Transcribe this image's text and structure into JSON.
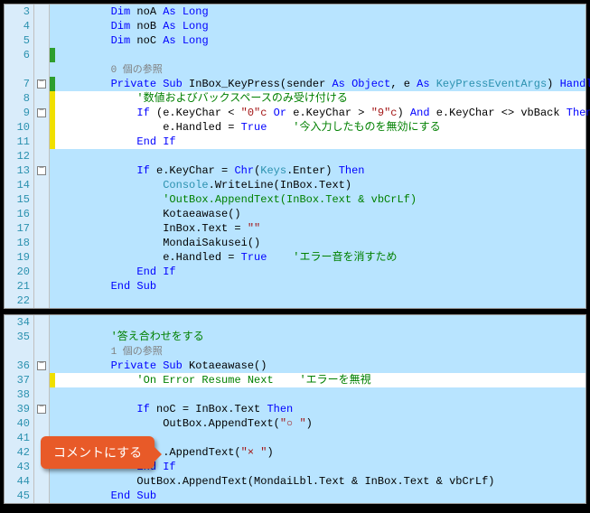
{
  "pane1": {
    "lines": [
      {
        "n": "3",
        "fold": "",
        "marker": "",
        "hl": false,
        "segs": [
          {
            "cls": "",
            "txt": "        "
          },
          {
            "cls": "kw",
            "txt": "Dim"
          },
          {
            "cls": "plain",
            "txt": " noA "
          },
          {
            "cls": "kw",
            "txt": "As"
          },
          {
            "cls": "plain",
            "txt": " "
          },
          {
            "cls": "kw",
            "txt": "Long"
          }
        ]
      },
      {
        "n": "4",
        "fold": "",
        "marker": "",
        "hl": false,
        "segs": [
          {
            "cls": "",
            "txt": "        "
          },
          {
            "cls": "kw",
            "txt": "Dim"
          },
          {
            "cls": "plain",
            "txt": " noB "
          },
          {
            "cls": "kw",
            "txt": "As"
          },
          {
            "cls": "plain",
            "txt": " "
          },
          {
            "cls": "kw",
            "txt": "Long"
          }
        ]
      },
      {
        "n": "5",
        "fold": "",
        "marker": "",
        "hl": false,
        "segs": [
          {
            "cls": "",
            "txt": "        "
          },
          {
            "cls": "kw",
            "txt": "Dim"
          },
          {
            "cls": "plain",
            "txt": " noC "
          },
          {
            "cls": "kw",
            "txt": "As"
          },
          {
            "cls": "plain",
            "txt": " "
          },
          {
            "cls": "kw",
            "txt": "Long"
          }
        ]
      },
      {
        "n": "6",
        "fold": "",
        "marker": "green",
        "hl": false,
        "segs": [
          {
            "cls": "",
            "txt": ""
          }
        ]
      },
      {
        "n": "",
        "fold": "",
        "marker": "",
        "hl": false,
        "segs": [
          {
            "cls": "",
            "txt": "        "
          },
          {
            "cls": "ref",
            "txt": "0 個の参照"
          }
        ]
      },
      {
        "n": "7",
        "fold": "box",
        "marker": "green",
        "hl": false,
        "segs": [
          {
            "cls": "",
            "txt": "        "
          },
          {
            "cls": "kw",
            "txt": "Private"
          },
          {
            "cls": "plain",
            "txt": " "
          },
          {
            "cls": "kw",
            "txt": "Sub"
          },
          {
            "cls": "plain",
            "txt": " InBox_KeyPress(sender "
          },
          {
            "cls": "kw",
            "txt": "As"
          },
          {
            "cls": "plain",
            "txt": " "
          },
          {
            "cls": "kw",
            "txt": "Object"
          },
          {
            "cls": "plain",
            "txt": ", e "
          },
          {
            "cls": "kw",
            "txt": "As"
          },
          {
            "cls": "plain",
            "txt": " "
          },
          {
            "cls": "type",
            "txt": "KeyPressEventArgs"
          },
          {
            "cls": "plain",
            "txt": ") "
          },
          {
            "cls": "kw",
            "txt": "Handles"
          }
        ]
      },
      {
        "n": "8",
        "fold": "",
        "marker": "yellow",
        "hl": true,
        "segs": [
          {
            "cls": "",
            "txt": "            "
          },
          {
            "cls": "comment",
            "txt": "'数値およびバックスペースのみ受け付ける"
          }
        ]
      },
      {
        "n": "9",
        "fold": "box",
        "marker": "yellow",
        "hl": true,
        "segs": [
          {
            "cls": "",
            "txt": "            "
          },
          {
            "cls": "kw",
            "txt": "If"
          },
          {
            "cls": "plain",
            "txt": " (e.KeyChar < "
          },
          {
            "cls": "str",
            "txt": "\"0\"c"
          },
          {
            "cls": "plain",
            "txt": " "
          },
          {
            "cls": "kw",
            "txt": "Or"
          },
          {
            "cls": "plain",
            "txt": " e.KeyChar > "
          },
          {
            "cls": "str",
            "txt": "\"9\"c"
          },
          {
            "cls": "plain",
            "txt": ") "
          },
          {
            "cls": "kw",
            "txt": "And"
          },
          {
            "cls": "plain",
            "txt": " e.KeyChar <> vbBack "
          },
          {
            "cls": "kw",
            "txt": "Then"
          }
        ]
      },
      {
        "n": "10",
        "fold": "",
        "marker": "yellow",
        "hl": true,
        "segs": [
          {
            "cls": "",
            "txt": "                "
          },
          {
            "cls": "plain",
            "txt": "e.Handled = "
          },
          {
            "cls": "kw",
            "txt": "True"
          },
          {
            "cls": "plain",
            "txt": "    "
          },
          {
            "cls": "comment",
            "txt": "'今入力したものを無効にする"
          }
        ]
      },
      {
        "n": "11",
        "fold": "",
        "marker": "yellow",
        "hl": true,
        "segs": [
          {
            "cls": "",
            "txt": "            "
          },
          {
            "cls": "kw",
            "txt": "End"
          },
          {
            "cls": "plain",
            "txt": " "
          },
          {
            "cls": "kw",
            "txt": "If"
          }
        ]
      },
      {
        "n": "12",
        "fold": "",
        "marker": "",
        "hl": false,
        "segs": [
          {
            "cls": "",
            "txt": ""
          }
        ]
      },
      {
        "n": "13",
        "fold": "box",
        "marker": "",
        "hl": false,
        "segs": [
          {
            "cls": "",
            "txt": "            "
          },
          {
            "cls": "kw",
            "txt": "If"
          },
          {
            "cls": "plain",
            "txt": " e.KeyChar = "
          },
          {
            "cls": "kw",
            "txt": "Chr"
          },
          {
            "cls": "plain",
            "txt": "("
          },
          {
            "cls": "type",
            "txt": "Keys"
          },
          {
            "cls": "plain",
            "txt": ".Enter) "
          },
          {
            "cls": "kw",
            "txt": "Then"
          }
        ]
      },
      {
        "n": "14",
        "fold": "",
        "marker": "",
        "hl": false,
        "segs": [
          {
            "cls": "",
            "txt": "                "
          },
          {
            "cls": "type",
            "txt": "Console"
          },
          {
            "cls": "plain",
            "txt": ".WriteLine(InBox.Text)"
          }
        ]
      },
      {
        "n": "15",
        "fold": "",
        "marker": "",
        "hl": false,
        "segs": [
          {
            "cls": "",
            "txt": "                "
          },
          {
            "cls": "comment",
            "txt": "'OutBox.AppendText(InBox.Text & vbCrLf)"
          }
        ]
      },
      {
        "n": "16",
        "fold": "",
        "marker": "",
        "hl": false,
        "segs": [
          {
            "cls": "",
            "txt": "                "
          },
          {
            "cls": "plain",
            "txt": "Kotaeawase()"
          }
        ]
      },
      {
        "n": "17",
        "fold": "",
        "marker": "",
        "hl": false,
        "segs": [
          {
            "cls": "",
            "txt": "                "
          },
          {
            "cls": "plain",
            "txt": "InBox.Text = "
          },
          {
            "cls": "str",
            "txt": "\"\""
          }
        ]
      },
      {
        "n": "18",
        "fold": "",
        "marker": "",
        "hl": false,
        "segs": [
          {
            "cls": "",
            "txt": "                "
          },
          {
            "cls": "plain",
            "txt": "MondaiSakusei()"
          }
        ]
      },
      {
        "n": "19",
        "fold": "",
        "marker": "",
        "hl": false,
        "segs": [
          {
            "cls": "",
            "txt": "                "
          },
          {
            "cls": "plain",
            "txt": "e.Handled = "
          },
          {
            "cls": "kw",
            "txt": "True"
          },
          {
            "cls": "plain",
            "txt": "    "
          },
          {
            "cls": "comment",
            "txt": "'エラー音を消すため"
          }
        ]
      },
      {
        "n": "20",
        "fold": "",
        "marker": "",
        "hl": false,
        "segs": [
          {
            "cls": "",
            "txt": "            "
          },
          {
            "cls": "kw",
            "txt": "End"
          },
          {
            "cls": "plain",
            "txt": " "
          },
          {
            "cls": "kw",
            "txt": "If"
          }
        ]
      },
      {
        "n": "21",
        "fold": "",
        "marker": "",
        "hl": false,
        "segs": [
          {
            "cls": "",
            "txt": "        "
          },
          {
            "cls": "kw",
            "txt": "End"
          },
          {
            "cls": "plain",
            "txt": " "
          },
          {
            "cls": "kw",
            "txt": "Sub"
          }
        ]
      },
      {
        "n": "22",
        "fold": "",
        "marker": "",
        "hl": false,
        "segs": [
          {
            "cls": "",
            "txt": ""
          }
        ]
      }
    ]
  },
  "pane2": {
    "lines": [
      {
        "n": "34",
        "fold": "",
        "marker": "",
        "hl": false,
        "segs": [
          {
            "cls": "",
            "txt": ""
          }
        ]
      },
      {
        "n": "35",
        "fold": "",
        "marker": "",
        "hl": false,
        "segs": [
          {
            "cls": "",
            "txt": "        "
          },
          {
            "cls": "comment",
            "txt": "'答え合わせをする"
          }
        ]
      },
      {
        "n": "",
        "fold": "",
        "marker": "",
        "hl": false,
        "segs": [
          {
            "cls": "",
            "txt": "        "
          },
          {
            "cls": "ref",
            "txt": "1 個の参照"
          }
        ]
      },
      {
        "n": "36",
        "fold": "box",
        "marker": "",
        "hl": false,
        "segs": [
          {
            "cls": "",
            "txt": "        "
          },
          {
            "cls": "kw",
            "txt": "Private"
          },
          {
            "cls": "plain",
            "txt": " "
          },
          {
            "cls": "kw",
            "txt": "Sub"
          },
          {
            "cls": "plain",
            "txt": " Kotaeawase()"
          }
        ]
      },
      {
        "n": "37",
        "fold": "",
        "marker": "yellow",
        "hl": true,
        "segs": [
          {
            "cls": "",
            "txt": "            "
          },
          {
            "cls": "comment",
            "txt": "'On Error Resume Next    'エラーを無視"
          }
        ]
      },
      {
        "n": "38",
        "fold": "",
        "marker": "",
        "hl": false,
        "segs": [
          {
            "cls": "",
            "txt": ""
          }
        ]
      },
      {
        "n": "39",
        "fold": "box",
        "marker": "",
        "hl": false,
        "segs": [
          {
            "cls": "",
            "txt": "            "
          },
          {
            "cls": "kw",
            "txt": "If"
          },
          {
            "cls": "plain",
            "txt": " noC = InBox.Text "
          },
          {
            "cls": "kw",
            "txt": "Then"
          }
        ]
      },
      {
        "n": "40",
        "fold": "",
        "marker": "",
        "hl": false,
        "segs": [
          {
            "cls": "",
            "txt": "                "
          },
          {
            "cls": "plain",
            "txt": "OutBox.AppendText("
          },
          {
            "cls": "str",
            "txt": "\"○ \""
          },
          {
            "cls": "plain",
            "txt": ")"
          }
        ]
      },
      {
        "n": "41",
        "fold": "",
        "marker": "",
        "hl": false,
        "segs": [
          {
            "cls": "",
            "txt": ""
          }
        ]
      },
      {
        "n": "42",
        "fold": "",
        "marker": "",
        "hl": false,
        "segs": [
          {
            "cls": "",
            "txt": "                "
          },
          {
            "cls": "plain",
            "txt": ".AppendText("
          },
          {
            "cls": "str",
            "txt": "\"× \""
          },
          {
            "cls": "plain",
            "txt": ")"
          }
        ]
      },
      {
        "n": "43",
        "fold": "",
        "marker": "",
        "hl": false,
        "segs": [
          {
            "cls": "",
            "txt": "            "
          },
          {
            "cls": "kw",
            "txt": "End"
          },
          {
            "cls": "plain",
            "txt": " "
          },
          {
            "cls": "kw",
            "txt": "If"
          }
        ]
      },
      {
        "n": "44",
        "fold": "",
        "marker": "",
        "hl": false,
        "segs": [
          {
            "cls": "",
            "txt": "            "
          },
          {
            "cls": "plain",
            "txt": "OutBox.AppendText(MondaiLbl.Text & InBox.Text & vbCrLf)"
          }
        ]
      },
      {
        "n": "45",
        "fold": "",
        "marker": "",
        "hl": false,
        "segs": [
          {
            "cls": "",
            "txt": "        "
          },
          {
            "cls": "kw",
            "txt": "End"
          },
          {
            "cls": "plain",
            "txt": " "
          },
          {
            "cls": "kw",
            "txt": "Sub"
          }
        ]
      }
    ]
  },
  "callout": {
    "text": "コメントにする"
  }
}
